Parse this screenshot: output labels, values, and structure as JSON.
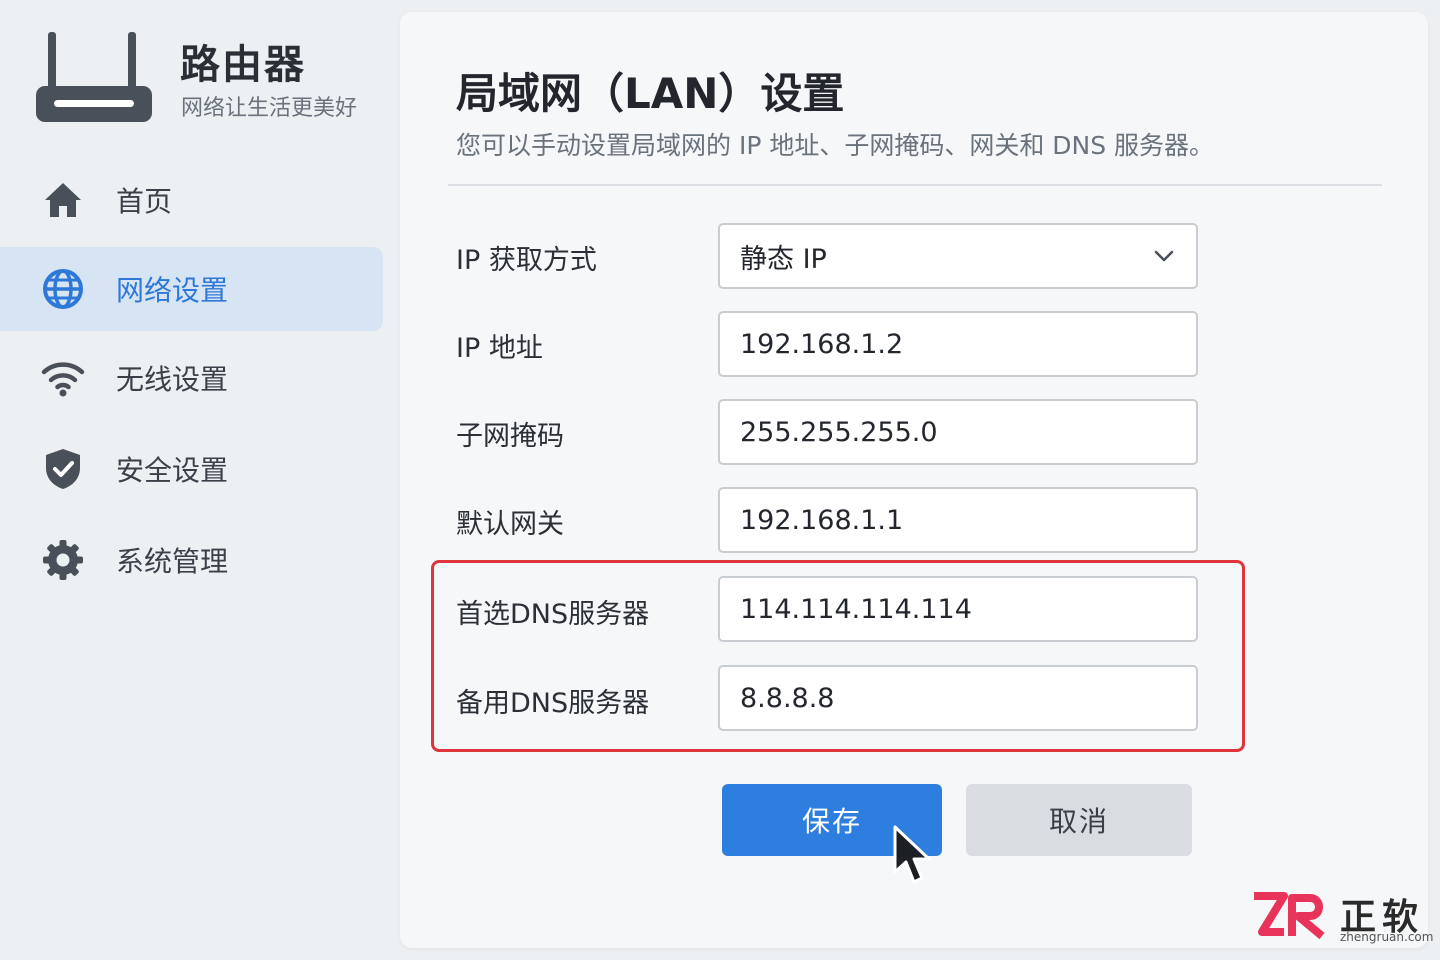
{
  "brand": {
    "title": "路由器",
    "subtitle": "网络让生活更美好",
    "icon": "router-icon"
  },
  "sidebar": {
    "items": [
      {
        "label": "首页",
        "icon": "home-icon",
        "active": false
      },
      {
        "label": "网络设置",
        "icon": "globe-icon",
        "active": true
      },
      {
        "label": "无线设置",
        "icon": "wifi-icon",
        "active": false
      },
      {
        "label": "安全设置",
        "icon": "shield-check-icon",
        "active": false
      },
      {
        "label": "系统管理",
        "icon": "gear-icon",
        "active": false
      }
    ]
  },
  "main": {
    "title": "局域网（LAN）设置",
    "description": "您可以手动设置局域网的 IP 地址、子网掩码、网关和 DNS 服务器。",
    "fields": {
      "ip_mode": {
        "label": "IP 获取方式",
        "value": "静态 IP"
      },
      "ip_address": {
        "label": "IP 地址",
        "value": "192.168.1.2"
      },
      "subnet_mask": {
        "label": "子网掩码",
        "value": "255.255.255.0"
      },
      "gateway": {
        "label": "默认网关",
        "value": "192.168.1.1"
      },
      "dns_primary": {
        "label": "首选DNS服务器",
        "value": "114.114.114.114"
      },
      "dns_secondary": {
        "label": "备用DNS服务器",
        "value": "8.8.8.8"
      }
    },
    "buttons": {
      "save": "保存",
      "cancel": "取消"
    }
  },
  "watermark": {
    "name": "正软",
    "url": "zhengruan.com"
  },
  "colors": {
    "accent": "#2e7ee0",
    "active_nav_bg": "#d6e4f3",
    "highlight_border": "#e0343c",
    "watermark_accent": "#e8345a"
  }
}
